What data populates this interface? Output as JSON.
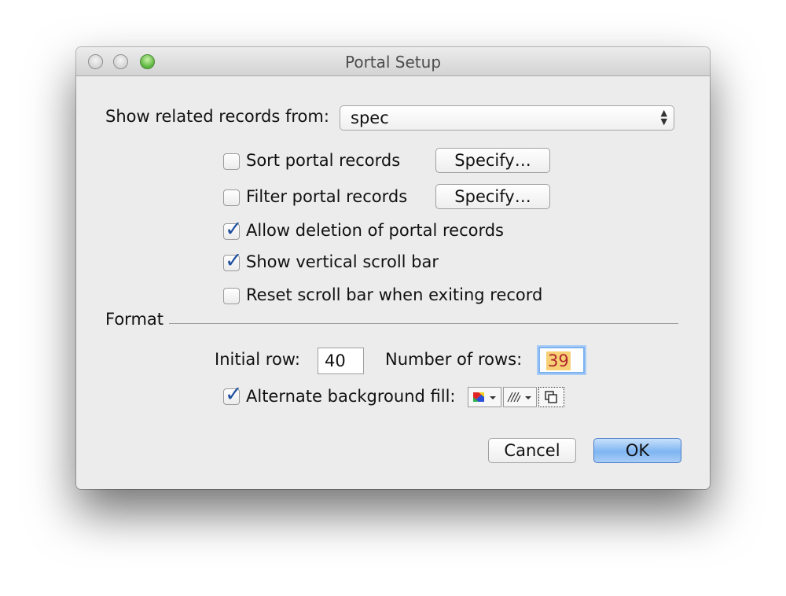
{
  "window": {
    "title": "Portal Setup"
  },
  "related": {
    "label": "Show related records from:",
    "value": "spec"
  },
  "options": {
    "sort": {
      "label": "Sort portal records",
      "button": "Specify…",
      "checked": false
    },
    "filter": {
      "label": "Filter portal records",
      "button": "Specify…",
      "checked": false
    },
    "allow_deletion": {
      "label": "Allow deletion of portal records",
      "checked": true
    },
    "vertical_scroll": {
      "label": "Show vertical scroll bar",
      "checked": true
    },
    "reset_scroll": {
      "label": "Reset scroll bar when exiting record",
      "checked": false
    }
  },
  "format": {
    "label": "Format",
    "initial_row_label": "Initial row:",
    "initial_row_value": "40",
    "num_rows_label": "Number of rows:",
    "num_rows_value": "39",
    "alt_fill_label": "Alternate background fill:",
    "alt_fill_checked": true
  },
  "buttons": {
    "cancel": "Cancel",
    "ok": "OK"
  },
  "colors": {
    "accent": "#1f4f9e",
    "focus": "#7db2f0",
    "selection": "#f7cf74"
  }
}
